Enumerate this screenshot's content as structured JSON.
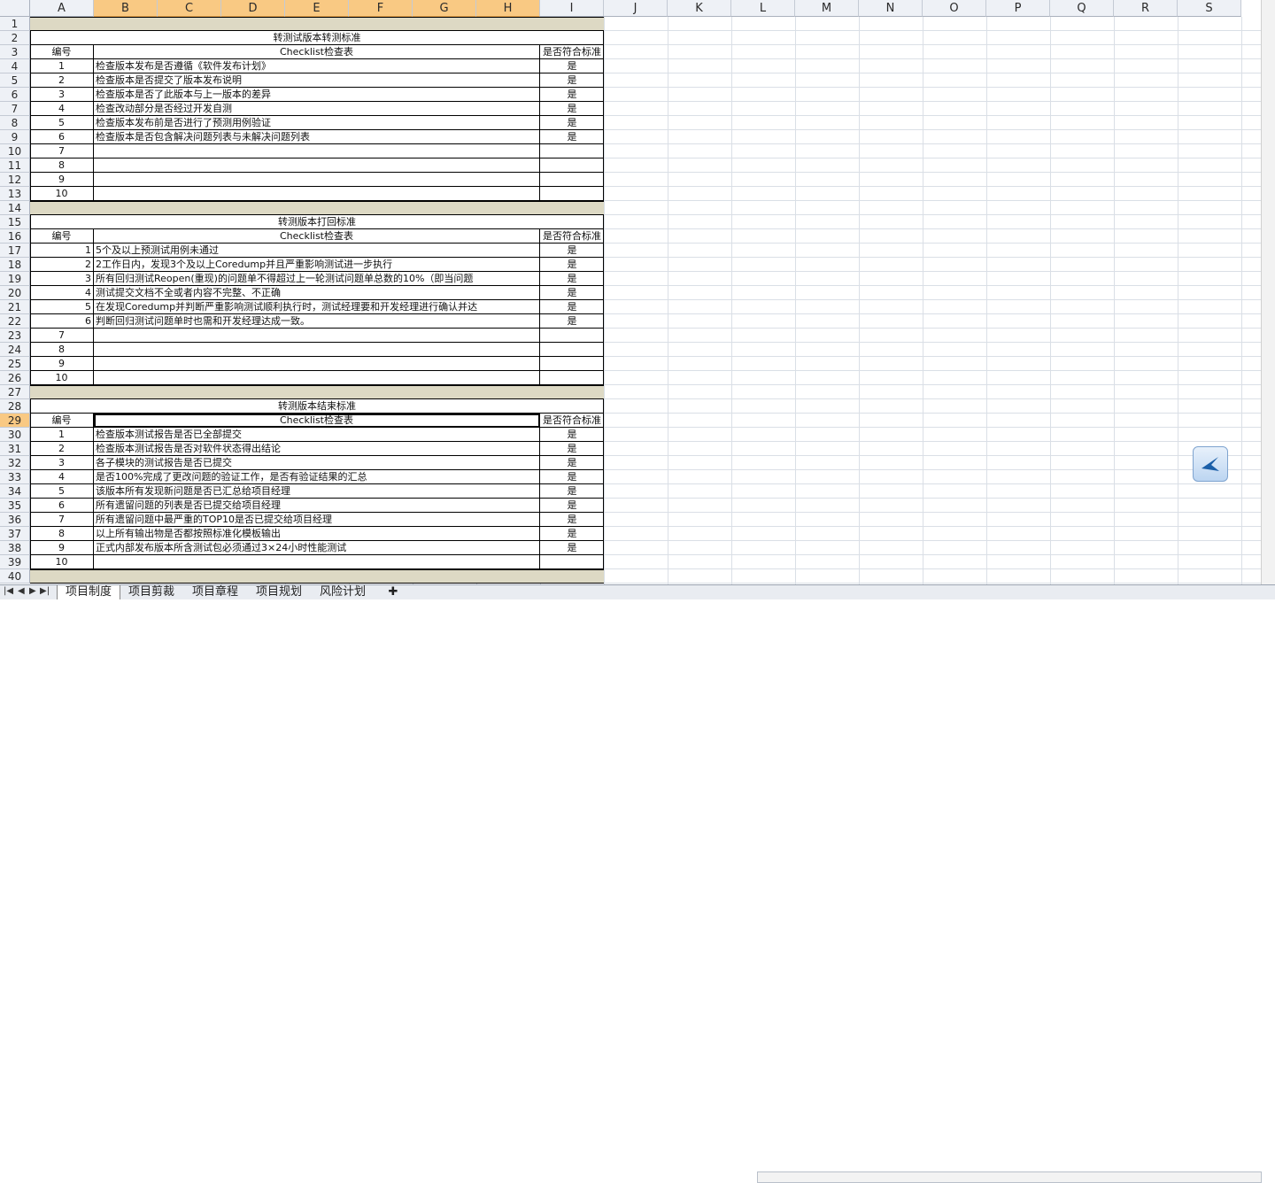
{
  "columns": [
    "A",
    "B",
    "C",
    "D",
    "E",
    "F",
    "G",
    "H",
    "I",
    "J",
    "K",
    "L",
    "M",
    "N",
    "O",
    "P",
    "Q",
    "R",
    "S"
  ],
  "rows": [
    "1",
    "2",
    "3",
    "4",
    "5",
    "6",
    "7",
    "8",
    "9",
    "10",
    "11",
    "12",
    "13",
    "14",
    "15",
    "16",
    "17",
    "18",
    "19",
    "20",
    "21",
    "22",
    "23",
    "24",
    "25",
    "26",
    "27",
    "28",
    "29",
    "30",
    "31",
    "32",
    "33",
    "34",
    "35",
    "36",
    "37",
    "38",
    "39",
    "40"
  ],
  "selected_row": "29",
  "sections": [
    {
      "title": "转测试版本转测标准",
      "header": {
        "no": "编号",
        "checklist": "Checklist检查表",
        "meets": "是否符合标准"
      },
      "items": [
        {
          "no": "1",
          "text": "检查版本发布是否遵循《软件发布计划》",
          "meets": "是"
        },
        {
          "no": "2",
          "text": "检查版本是否提交了版本发布说明",
          "meets": "是"
        },
        {
          "no": "3",
          "text": "检查版本是否了此版本与上一版本的差异",
          "meets": "是"
        },
        {
          "no": "4",
          "text": "检查改动部分是否经过开发自测",
          "meets": "是"
        },
        {
          "no": "5",
          "text": "检查版本发布前是否进行了预测用例验证",
          "meets": "是"
        },
        {
          "no": "6",
          "text": "检查版本是否包含解决问题列表与未解决问题列表",
          "meets": "是"
        },
        {
          "no": "7",
          "text": "",
          "meets": ""
        },
        {
          "no": "8",
          "text": "",
          "meets": ""
        },
        {
          "no": "9",
          "text": "",
          "meets": ""
        },
        {
          "no": "10",
          "text": "",
          "meets": ""
        }
      ]
    },
    {
      "title": "转测版本打回标准",
      "header": {
        "no": "编号",
        "checklist": "Checklist检查表",
        "meets": "是否符合标准"
      },
      "items": [
        {
          "no": "1",
          "text": "5个及以上预测试用例未通过",
          "meets": "是"
        },
        {
          "no": "2",
          "text": "2工作日内，发现3个及以上Coredump并且严重影响测试进一步执行",
          "meets": "是"
        },
        {
          "no": "3",
          "text": "所有回归测试Reopen(重现)的问题单不得超过上一轮测试问题单总数的10%（即当问题",
          "meets": "是"
        },
        {
          "no": "4",
          "text": "测试提交文档不全或者内容不完整、不正确",
          "meets": "是"
        },
        {
          "no": "5",
          "text": "在发现Coredump并判断严重影响测试顺利执行时，测试经理要和开发经理进行确认并达",
          "meets": "是"
        },
        {
          "no": "6",
          "text": "判断回归测试问题单时也需和开发经理达成一致。",
          "meets": "是"
        },
        {
          "no": "7",
          "text": "",
          "meets": ""
        },
        {
          "no": "8",
          "text": "",
          "meets": ""
        },
        {
          "no": "9",
          "text": "",
          "meets": ""
        },
        {
          "no": "10",
          "text": "",
          "meets": ""
        }
      ]
    },
    {
      "title": "转测版本结束标准",
      "header": {
        "no": "编号",
        "checklist": "Checklist检查表",
        "meets": "是否符合标准"
      },
      "items": [
        {
          "no": "1",
          "text": "检查版本测试报告是否已全部提交",
          "meets": "是"
        },
        {
          "no": "2",
          "text": "检查版本测试报告是否对软件状态得出结论",
          "meets": "是"
        },
        {
          "no": "3",
          "text": "各子模块的测试报告是否已提交",
          "meets": "是"
        },
        {
          "no": "4",
          "text": "是否100%完成了更改问题的验证工作，是否有验证结果的汇总",
          "meets": "是"
        },
        {
          "no": "5",
          "text": "该版本所有发现新问题是否已汇总给项目经理",
          "meets": "是"
        },
        {
          "no": "6",
          "text": "所有遗留问题的列表是否已提交给项目经理",
          "meets": "是"
        },
        {
          "no": "7",
          "text": "所有遗留问题中最严重的TOP10是否已提交给项目经理",
          "meets": "是"
        },
        {
          "no": "8",
          "text": "以上所有输出物是否都按照标准化模板输出",
          "meets": "是"
        },
        {
          "no": "9",
          "text": "正式内部发布版本所含测试包必须通过3×24小时性能测试",
          "meets": "是"
        },
        {
          "no": "10",
          "text": "",
          "meets": ""
        }
      ]
    }
  ],
  "sheet_tabs": [
    "项目制度",
    "项目剪裁",
    "项目章程",
    "项目规划",
    "风险计划"
  ],
  "active_tab": "项目制度",
  "colors": {
    "band": "#ddd9c4",
    "header_bg": "#eef1f6",
    "selected_header": "#f9c983"
  }
}
